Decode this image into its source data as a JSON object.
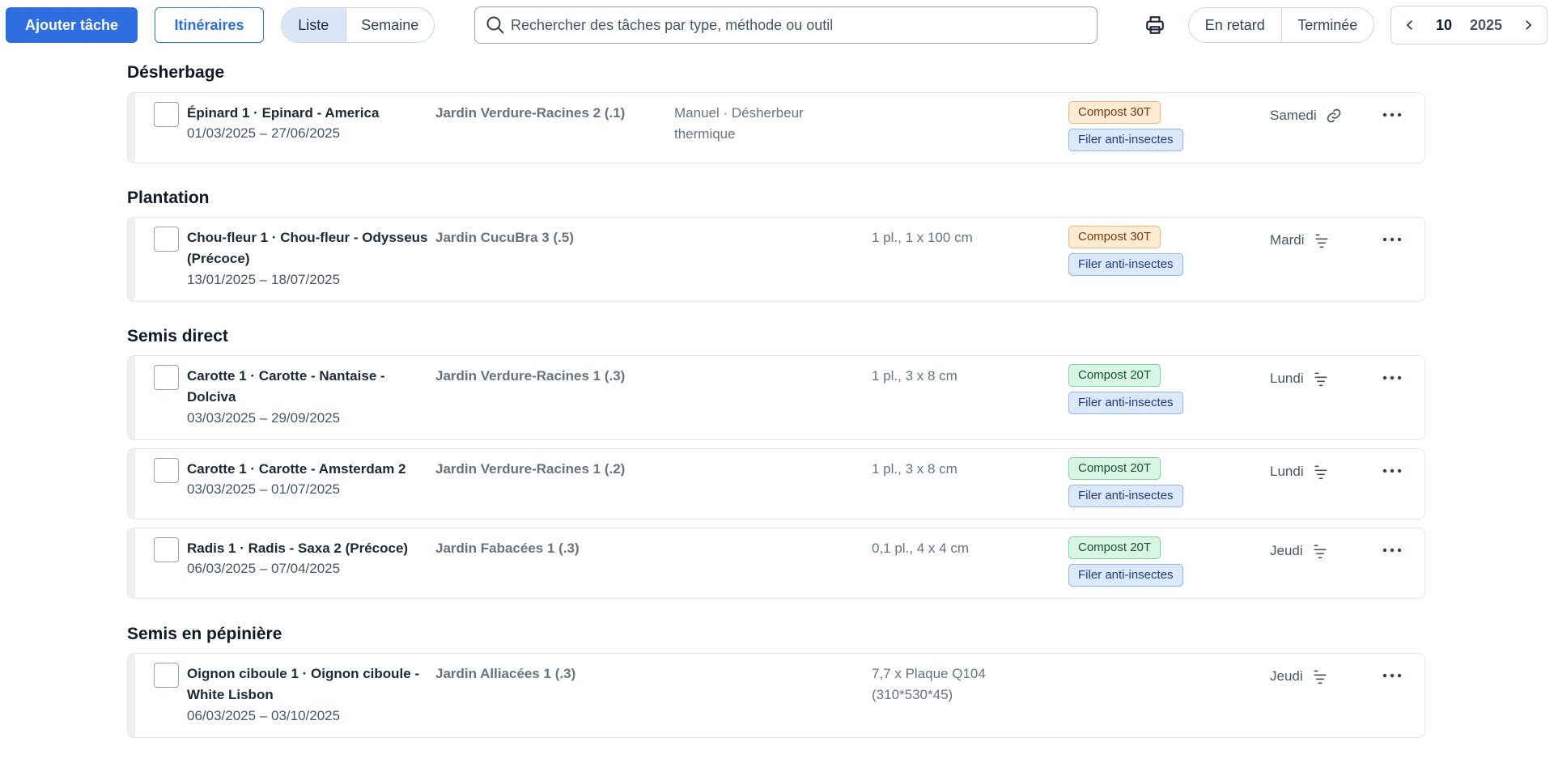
{
  "toolbar": {
    "add_task": "Ajouter tâche",
    "itineraries": "Itinéraires",
    "view": {
      "list": "Liste",
      "week": "Semaine"
    },
    "search_placeholder": "Rechercher des tâches par type, méthode ou outil",
    "status": {
      "late": "En retard",
      "done": "Terminée"
    },
    "period": {
      "week": "10",
      "year": "2025"
    }
  },
  "icons": {
    "search": "search-icon",
    "print": "printer-icon",
    "prev": "chevron-left-icon",
    "next": "chevron-right-icon",
    "link": "link-icon",
    "filter": "filter-lines-icon",
    "more": "more-horizontal-icon"
  },
  "colors": {
    "primary": "#2f6ee0",
    "tag_orange_bg": "#fdebd6",
    "tag_green_bg": "#d9f5e4",
    "tag_blue_bg": "#dbe9fb"
  },
  "sections": [
    {
      "title": "Désherbage",
      "tasks": [
        {
          "title": "Épinard 1 · Epinard - America",
          "dates": "01/03/2025 – 27/06/2025",
          "location": "Jardin Verdure-Racines 2 (.1)",
          "method": "Manuel · Désherbeur thermique",
          "spacing": "",
          "tags": [
            "Compost 30T",
            "Filer anti-insectes"
          ],
          "day": "Samedi"
        }
      ]
    },
    {
      "title": "Plantation",
      "tasks": [
        {
          "title": "Chou-fleur 1 · Chou-fleur - Odysseus (Précoce)",
          "dates": "13/01/2025 – 18/07/2025",
          "location": "Jardin CucuBra 3 (.5)",
          "method": "",
          "spacing": "1 pl., 1 x 100 cm",
          "tags": [
            "Compost 30T",
            "Filer anti-insectes"
          ],
          "day": "Mardi"
        }
      ]
    },
    {
      "title": "Semis direct",
      "tasks": [
        {
          "title": "Carotte 1 · Carotte - Nantaise - Dolciva",
          "dates": "03/03/2025 – 29/09/2025",
          "location": "Jardin Verdure-Racines 1 (.3)",
          "method": "",
          "spacing": "1 pl., 3 x 8 cm",
          "tags": [
            "Compost 20T",
            "Filer anti-insectes"
          ],
          "day": "Lundi"
        },
        {
          "title": "Carotte 1 · Carotte - Amsterdam 2",
          "dates": "03/03/2025 – 01/07/2025",
          "location": "Jardin Verdure-Racines 1 (.2)",
          "method": "",
          "spacing": "1 pl., 3 x 8 cm",
          "tags": [
            "Compost 20T",
            "Filer anti-insectes"
          ],
          "day": "Lundi"
        },
        {
          "title": "Radis 1 · Radis - Saxa 2 (Précoce)",
          "dates": "06/03/2025 – 07/04/2025",
          "location": "Jardin Fabacées 1 (.3)",
          "method": "",
          "spacing": "0,1 pl., 4 x 4 cm",
          "tags": [
            "Compost 20T",
            "Filer anti-insectes"
          ],
          "day": "Jeudi"
        }
      ]
    },
    {
      "title": "Semis en pépinière",
      "tasks": [
        {
          "title": "Oignon ciboule 1 · Oignon ciboule - White Lisbon",
          "dates": "06/03/2025 – 03/10/2025",
          "location": "Jardin Alliacées 1 (.3)",
          "method": "",
          "spacing": "7,7 x Plaque Q104 (310*530*45)",
          "tags": [],
          "day": "Jeudi"
        }
      ]
    }
  ]
}
